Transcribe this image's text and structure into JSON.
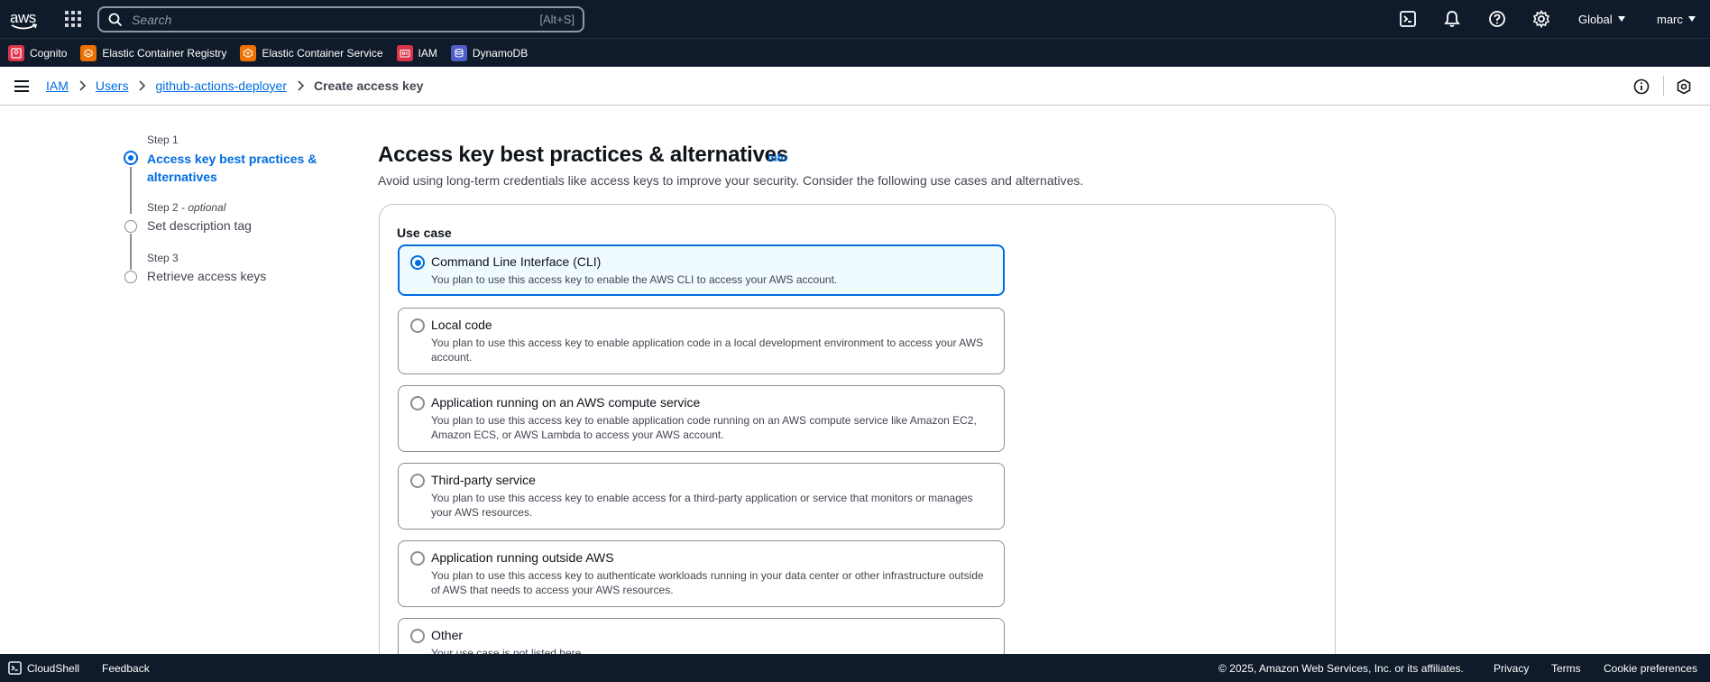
{
  "topnav": {
    "logo_text": "aws",
    "search_placeholder": "Search",
    "search_shortcut": "[Alt+S]",
    "region": "Global",
    "user": "marc",
    "icons": [
      "cloudshell-icon",
      "bell-icon",
      "help-icon",
      "gear-icon"
    ]
  },
  "favorites": [
    {
      "label": "Cognito",
      "color": "#e7157b",
      "icon": "cognito-icon"
    },
    {
      "label": "Elastic Container Registry",
      "color": "#ed7100",
      "icon": "ecr-icon"
    },
    {
      "label": "Elastic Container Service",
      "color": "#ed7100",
      "icon": "ecs-icon"
    },
    {
      "label": "IAM",
      "color": "#dd344c",
      "icon": "iam-icon"
    },
    {
      "label": "DynamoDB",
      "color": "#4d5ec9",
      "icon": "dynamodb-icon"
    }
  ],
  "breadcrumb": {
    "items": [
      "IAM",
      "Users",
      "github-actions-deployer"
    ],
    "current": "Create access key"
  },
  "steps": [
    {
      "label": "Step 1",
      "optional": "",
      "title": "Access key best practices & alternatives",
      "title_line1": "Access key best practices &",
      "title_line2": "alternatives",
      "state": "active"
    },
    {
      "label": "Step 2 - ",
      "optional": "optional",
      "title": "Set description tag",
      "state": "inactive"
    },
    {
      "label": "Step 3",
      "optional": "",
      "title": "Retrieve access keys",
      "state": "inactive"
    }
  ],
  "main": {
    "title": "Access key best practices & alternatives",
    "info": "Info",
    "description": "Avoid using long-term credentials like access keys to improve your security. Consider the following use cases and alternatives.",
    "usecase_label": "Use case",
    "options": [
      {
        "title": "Command Line Interface (CLI)",
        "desc": "You plan to use this access key to enable the AWS CLI to access your AWS account.",
        "selected": true
      },
      {
        "title": "Local code",
        "desc": "You plan to use this access key to enable application code in a local development environment to access your AWS account.",
        "selected": false
      },
      {
        "title": "Application running on an AWS compute service",
        "desc": "You plan to use this access key to enable application code running on an AWS compute service like Amazon EC2, Amazon ECS, or AWS Lambda to access your AWS account.",
        "selected": false
      },
      {
        "title": "Third-party service",
        "desc": "You plan to use this access key to enable access for a third-party application or service that monitors or manages your AWS resources.",
        "selected": false
      },
      {
        "title": "Application running outside AWS",
        "desc": "You plan to use this access key to authenticate workloads running in your data center or other infrastructure outside of AWS that needs to access your AWS resources.",
        "selected": false
      },
      {
        "title": "Other",
        "desc": "Your use case is not listed here.",
        "selected": false
      }
    ]
  },
  "footer": {
    "cloudshell": "CloudShell",
    "feedback": "Feedback",
    "copyright": "© 2025, Amazon Web Services, Inc. or its affiliates.",
    "privacy": "Privacy",
    "terms": "Terms",
    "cookie": "Cookie preferences"
  }
}
